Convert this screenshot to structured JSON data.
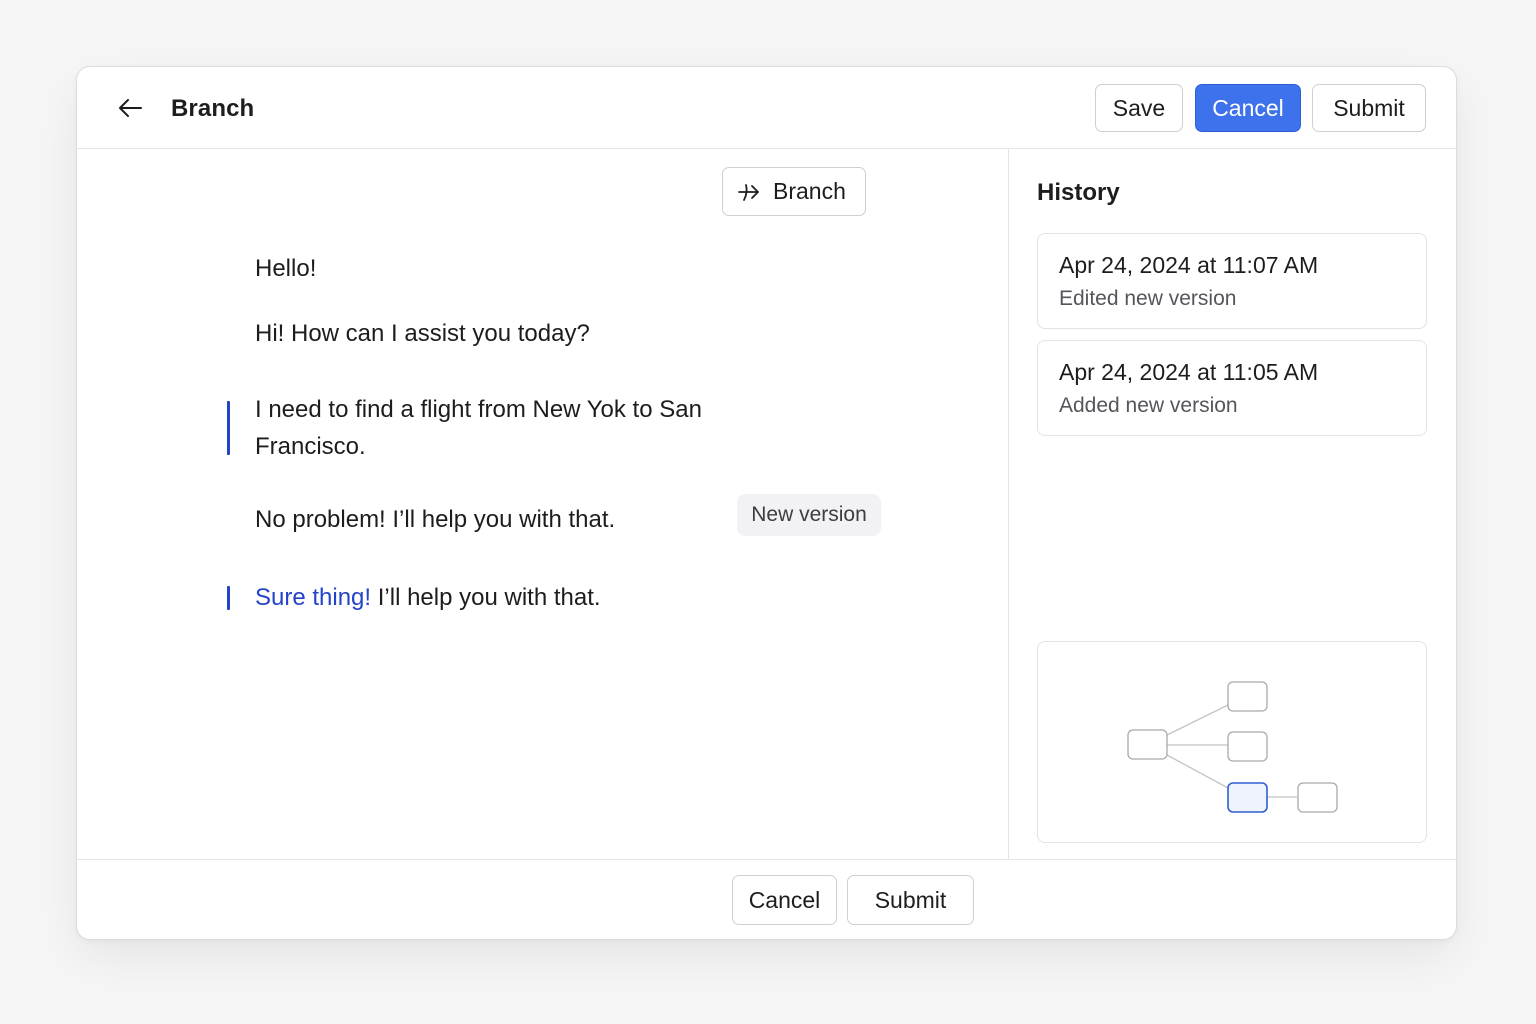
{
  "header": {
    "title": "Branch",
    "back_icon": "arrow-left-icon",
    "save_label": "Save",
    "cancel_label": "Cancel",
    "submit_label": "Submit"
  },
  "colors": {
    "primary": "#3d72ec",
    "accent_text": "#2443c9",
    "selected_node_fill": "#eef3fc"
  },
  "main": {
    "branch_button": {
      "label": "Branch",
      "icon": "branch-arrow-icon"
    },
    "messages": [
      {
        "text": "Hello!"
      },
      {
        "text": "Hi! How can I assist you today?"
      },
      {
        "text": "I need to find a flight from New Yok  to San Francisco.",
        "edited": true
      },
      {
        "text": "No problem! I’ll help you with that.",
        "tag": "New version"
      },
      {
        "highlight": "Sure thing!",
        "rest": " I’ll help you with that.",
        "edited": true
      }
    ]
  },
  "sidebar": {
    "history_title": "History",
    "history": [
      {
        "time": "Apr 24, 2024 at 11:07 AM",
        "description": "Edited new version"
      },
      {
        "time": "Apr 24, 2024 at 11:05 AM",
        "description": "Added new version"
      }
    ],
    "version_graph": {
      "nodes": [
        "root",
        "child-1",
        "child-2",
        "child-3",
        "grandchild-1"
      ],
      "edges": [
        [
          "root",
          "child-1"
        ],
        [
          "root",
          "child-2"
        ],
        [
          "root",
          "child-3"
        ],
        [
          "child-3",
          "grandchild-1"
        ]
      ],
      "selected": "child-3"
    }
  },
  "footer": {
    "cancel_label": "Cancel",
    "submit_label": "Submit"
  }
}
